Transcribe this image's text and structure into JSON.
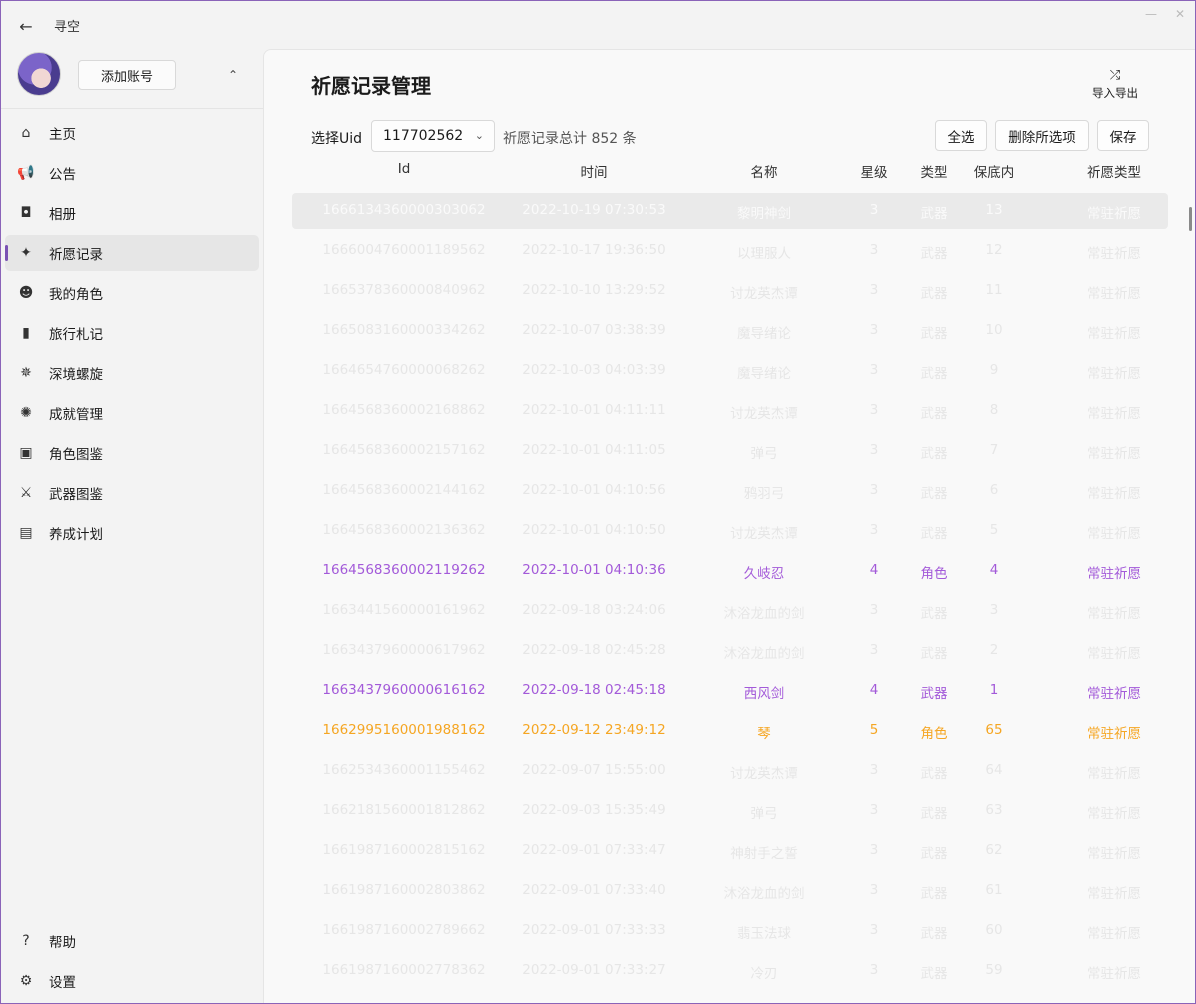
{
  "app": {
    "title": "寻空"
  },
  "window_controls": [
    "—",
    "✕"
  ],
  "account": {
    "add_label": "添加账号"
  },
  "nav": {
    "items": [
      {
        "label": "主页",
        "icon": "home-icon",
        "glyph": "⌂"
      },
      {
        "label": "公告",
        "icon": "megaphone-icon",
        "glyph": "📢"
      },
      {
        "label": "相册",
        "icon": "camera-icon",
        "glyph": "◘"
      },
      {
        "label": "祈愿记录",
        "icon": "sparkle-icon",
        "glyph": "✦"
      },
      {
        "label": "我的角色",
        "icon": "character-icon",
        "glyph": "☻"
      },
      {
        "label": "旅行札记",
        "icon": "book-icon",
        "glyph": "▮"
      },
      {
        "label": "深境螺旋",
        "icon": "abyss-icon",
        "glyph": "✵"
      },
      {
        "label": "成就管理",
        "icon": "achievement-icon",
        "glyph": "✺"
      },
      {
        "label": "角色图鉴",
        "icon": "character-archive-icon",
        "glyph": "▣"
      },
      {
        "label": "武器图鉴",
        "icon": "weapon-icon",
        "glyph": "⚔"
      },
      {
        "label": "养成计划",
        "icon": "plan-icon",
        "glyph": "▤"
      }
    ],
    "bottom": [
      {
        "label": "帮助",
        "icon": "help-icon",
        "glyph": "?"
      },
      {
        "label": "设置",
        "icon": "settings-icon",
        "glyph": "⚙"
      }
    ]
  },
  "page": {
    "title": "祈愿记录管理",
    "import_export_label": "导入导出",
    "uid_label": "选择Uid",
    "uid_value": "117702562",
    "total_text": "祈愿记录总计 852 条",
    "select_all_label": "全选",
    "delete_label": "删除所选项",
    "save_label": "保存"
  },
  "table": {
    "columns": [
      "Id",
      "时间",
      "名称",
      "星级",
      "类型",
      "保底内",
      "祈愿类型"
    ],
    "rows": [
      [
        "1666134360000303062",
        "2022-10-19 07:30:53",
        "黎明神剑",
        "3",
        "武器",
        "13",
        "常驻祈愿"
      ],
      [
        "1666004760001189562",
        "2022-10-17 19:36:50",
        "以理服人",
        "3",
        "武器",
        "12",
        "常驻祈愿"
      ],
      [
        "1665378360000840962",
        "2022-10-10 13:29:52",
        "讨龙英杰谭",
        "3",
        "武器",
        "11",
        "常驻祈愿"
      ],
      [
        "1665083160000334262",
        "2022-10-07 03:38:39",
        "魔导绪论",
        "3",
        "武器",
        "10",
        "常驻祈愿"
      ],
      [
        "1664654760000068262",
        "2022-10-03 04:03:39",
        "魔导绪论",
        "3",
        "武器",
        "9",
        "常驻祈愿"
      ],
      [
        "1664568360002168862",
        "2022-10-01 04:11:11",
        "讨龙英杰谭",
        "3",
        "武器",
        "8",
        "常驻祈愿"
      ],
      [
        "1664568360002157162",
        "2022-10-01 04:11:05",
        "弹弓",
        "3",
        "武器",
        "7",
        "常驻祈愿"
      ],
      [
        "1664568360002144162",
        "2022-10-01 04:10:56",
        "鸦羽弓",
        "3",
        "武器",
        "6",
        "常驻祈愿"
      ],
      [
        "1664568360002136362",
        "2022-10-01 04:10:50",
        "讨龙英杰谭",
        "3",
        "武器",
        "5",
        "常驻祈愿"
      ],
      [
        "1664568360002119262",
        "2022-10-01 04:10:36",
        "久岐忍",
        "4",
        "角色",
        "4",
        "常驻祈愿"
      ],
      [
        "1663441560000161962",
        "2022-09-18 03:24:06",
        "沐浴龙血的剑",
        "3",
        "武器",
        "3",
        "常驻祈愿"
      ],
      [
        "1663437960000617962",
        "2022-09-18 02:45:28",
        "沐浴龙血的剑",
        "3",
        "武器",
        "2",
        "常驻祈愿"
      ],
      [
        "1663437960000616162",
        "2022-09-18 02:45:18",
        "西风剑",
        "4",
        "武器",
        "1",
        "常驻祈愿"
      ],
      [
        "1662995160001988162",
        "2022-09-12 23:49:12",
        "琴",
        "5",
        "角色",
        "65",
        "常驻祈愿"
      ],
      [
        "1662534360001155462",
        "2022-09-07 15:55:00",
        "讨龙英杰谭",
        "3",
        "武器",
        "64",
        "常驻祈愿"
      ],
      [
        "1662181560001812862",
        "2022-09-03 15:35:49",
        "弹弓",
        "3",
        "武器",
        "63",
        "常驻祈愿"
      ],
      [
        "1661987160002815162",
        "2022-09-01 07:33:47",
        "神射手之誓",
        "3",
        "武器",
        "62",
        "常驻祈愿"
      ],
      [
        "1661987160002803862",
        "2022-09-01 07:33:40",
        "沐浴龙血的剑",
        "3",
        "武器",
        "61",
        "常驻祈愿"
      ],
      [
        "1661987160002789662",
        "2022-09-01 07:33:33",
        "翡玉法球",
        "3",
        "武器",
        "60",
        "常驻祈愿"
      ],
      [
        "1661987160002778362",
        "2022-09-01 07:33:27",
        "冷刃",
        "3",
        "武器",
        "59",
        "常驻祈愿"
      ]
    ]
  },
  "colors": {
    "accent": "#7a52b3",
    "rank4": "#a35ad9",
    "rank5": "#f5a623",
    "rank3": "#e6e6e6"
  }
}
